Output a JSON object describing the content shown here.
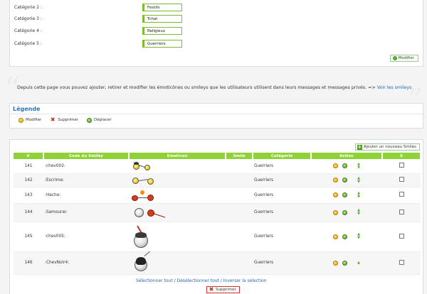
{
  "categories": {
    "rows": [
      {
        "label": "Catégorie 2 :",
        "value": "Festifs"
      },
      {
        "label": "Catégorie 3 :",
        "value": "Tchat"
      },
      {
        "label": "Catégorie 4 :",
        "value": "Religieux"
      },
      {
        "label": "Catégorie 5 :",
        "value": "Guerriers"
      }
    ],
    "submit_label": "Modifier"
  },
  "info": {
    "text": "Depuis cette page vous pouvez ajouter, retirer et modifier les émoticônes ou smileys que les utilisateurs utilisent dans leurs messages et messages privés. =>",
    "link": "Voir les smileys"
  },
  "legend": {
    "title": "Légende",
    "items": [
      "Modifier",
      "Supprimer",
      "Déplacer"
    ]
  },
  "table": {
    "add_label": "Ajouter un nouveau Smiles",
    "headers": [
      "#",
      "Code du Smiley",
      "Emoticon",
      "Smile",
      "Catégorie",
      "Action",
      "X"
    ],
    "rows": [
      {
        "num": "141",
        "code": ":chev002:",
        "category": "Guerriers"
      },
      {
        "num": "142",
        "code": ":Escrime:",
        "category": "Guerriers"
      },
      {
        "num": "143",
        "code": ":Hache:",
        "category": "Guerriers"
      },
      {
        "num": "144",
        "code": ":Samourai:",
        "category": "Guerriers"
      },
      {
        "num": "145",
        "code": ":chev005:",
        "category": "Guerriers"
      },
      {
        "num": "146",
        "code": ":ChevNoir4:",
        "category": "Guerriers"
      }
    ]
  },
  "footer": {
    "select_all": "Sélectionner tout",
    "deselect_all": "Désélectionner tout",
    "invert": "Inverser la sélection",
    "separator": "/",
    "delete_label": "Supprimer"
  },
  "colors": {
    "header_green": "#8ed235",
    "accent_blue": "#2a79b8",
    "input_border": "#7bbd2a"
  }
}
